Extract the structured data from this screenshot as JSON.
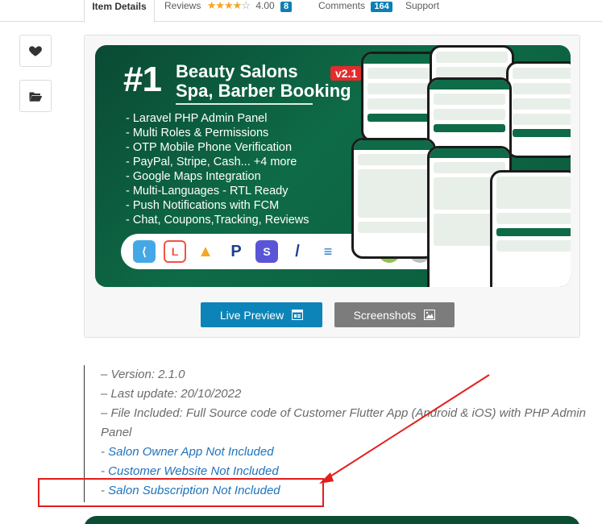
{
  "tabs": {
    "item_details": "Item Details",
    "reviews": "Reviews",
    "rating": "4.00",
    "reviews_count": "8",
    "comments": "Comments",
    "comments_count": "164",
    "support": "Support"
  },
  "side_actions": {
    "favorite_icon": "heart-icon",
    "collection_icon": "folder-open-icon"
  },
  "banner": {
    "rank": "#1",
    "title_line1": "Beauty Salons",
    "title_line2": "Spa, Barber Booking",
    "version": "v2.1",
    "features": [
      "- Laravel PHP Admin Panel",
      "- Multi Roles & Permissions",
      "- OTP Mobile Phone Verification",
      "- PayPal, Stripe, Cash... +4 more",
      "- Google Maps Integration",
      "- Multi-Languages - RTL Ready",
      "- Push Notifications with FCM",
      "- Chat, Coupons,Tracking, Reviews"
    ],
    "tech_icons": [
      "flutter-icon",
      "laravel-icon",
      "firebase-icon",
      "paypal-icon",
      "stripe-icon",
      "razorpay-icon",
      "flutterwave-icon",
      "xendit-icon",
      "android-icon",
      "apple-icon"
    ]
  },
  "preview_buttons": {
    "live_preview": "Live Preview",
    "screenshots": "Screenshots"
  },
  "description": {
    "version": "– Version: 2.1.0",
    "last_update": "– Last update: 20/10/2022",
    "files_included": "– File Included: Full Source code of Customer Flutter App (Android & iOS) with PHP Admin Panel",
    "salon_owner": "Salon Owner App Not Included",
    "customer_website": "Customer Website Not Included",
    "salon_subscription": "Salon Subscription Not Included",
    "dash": "- "
  },
  "colors": {
    "accent": "#0d84b8",
    "banner_green": "#0e6b47",
    "annotation_red": "#e41d1d",
    "link_blue": "#1e73be"
  }
}
